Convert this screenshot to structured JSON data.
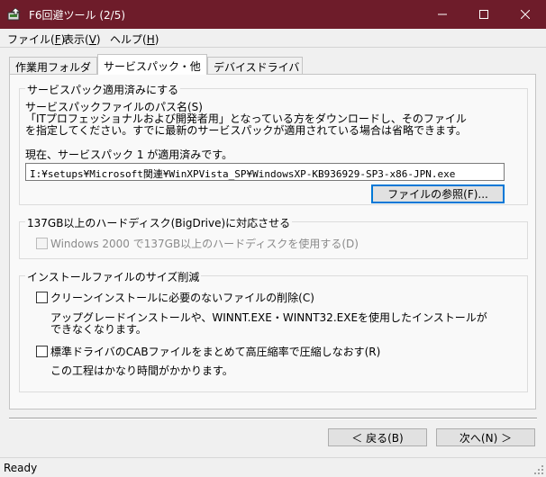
{
  "window": {
    "title": "F6回避ツール (2/5)",
    "title_bar_color": "#6e1c2a",
    "controls": {
      "minimize_icon": "minimize-icon",
      "maximize_icon": "maximize-icon",
      "close_icon": "close-icon"
    }
  },
  "menu": {
    "file": {
      "label": "ファイル(",
      "key": "F",
      "end": ")"
    },
    "view": {
      "label": "表示(",
      "key": "V",
      "end": ")"
    },
    "help": {
      "label": "ヘルプ(",
      "key": "H",
      "end": ")"
    }
  },
  "tabs": [
    {
      "label": "作業用フォルダ",
      "active": false
    },
    {
      "label": "サービスパック・他",
      "active": true
    },
    {
      "label": "デバイスドライバ",
      "active": false
    }
  ],
  "sp_group": {
    "title": "サービスパック適用済みにする",
    "path_label": "サービスパックファイルのパス名(S)",
    "desc_line1": "「ITプロフェッショナルおよび開発者用」となっている方をダウンロードし、そのファイル",
    "desc_line2": "を指定してください。すでに最新のサービスパックが適用されている場合は省略できます。",
    "current_status": "現在、サービスパック 1 が適用済みです。",
    "path_value": "I:¥setups¥Microsoft関連¥WinXPVista_SP¥WindowsXP-KB936929-SP3-x86-JPN.exe",
    "browse_button": "ファイルの参照(F)..."
  },
  "bigdrive_group": {
    "title": "137GB以上のハードディスク(BigDrive)に対応させる",
    "checkbox_label": "Windows 2000 で137GB以上のハードディスクを使用する(D)",
    "checked": false,
    "enabled": false
  },
  "size_group": {
    "title": "インストールファイルのサイズ削減",
    "option1_label": "クリーンインストールに必要のないファイルの削除(C)",
    "option1_checked": false,
    "option1_desc_line1": "アップグレードインストールや、WINNT.EXE・WINNT32.EXEを使用したインストールが",
    "option1_desc_line2": "できなくなります。",
    "option2_label": "標準ドライバのCABファイルをまとめて高圧縮率で圧縮しなおす(R)",
    "option2_checked": false,
    "option2_desc": "この工程はかなり時間がかかります。"
  },
  "nav": {
    "back_button": "＜ 戻る(B)",
    "next_button": "次へ(N) ＞"
  },
  "status": {
    "text": "Ready"
  }
}
